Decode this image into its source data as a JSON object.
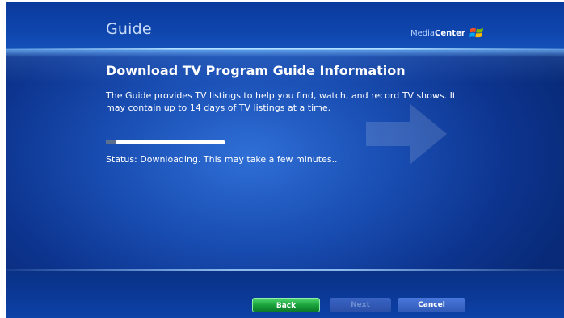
{
  "header": {
    "title": "Guide",
    "brand_light": "Media",
    "brand_bold": "Center",
    "logo_icon": "windows-logo-icon"
  },
  "content": {
    "heading": "Download TV Program Guide Information",
    "description": "The Guide provides TV listings to help you find, watch, and record TV shows. It may contain up to 14 days of TV listings at a time.",
    "progress_fraction": 0.08,
    "status": "Status: Downloading. This may take a few minutes.."
  },
  "footer": {
    "back_label": "Back",
    "next_label": "Next",
    "cancel_label": "Cancel"
  },
  "colors": {
    "background": "#1a4fb4",
    "back_button": "#1aa23c",
    "button_blue": "#2f59b6"
  }
}
